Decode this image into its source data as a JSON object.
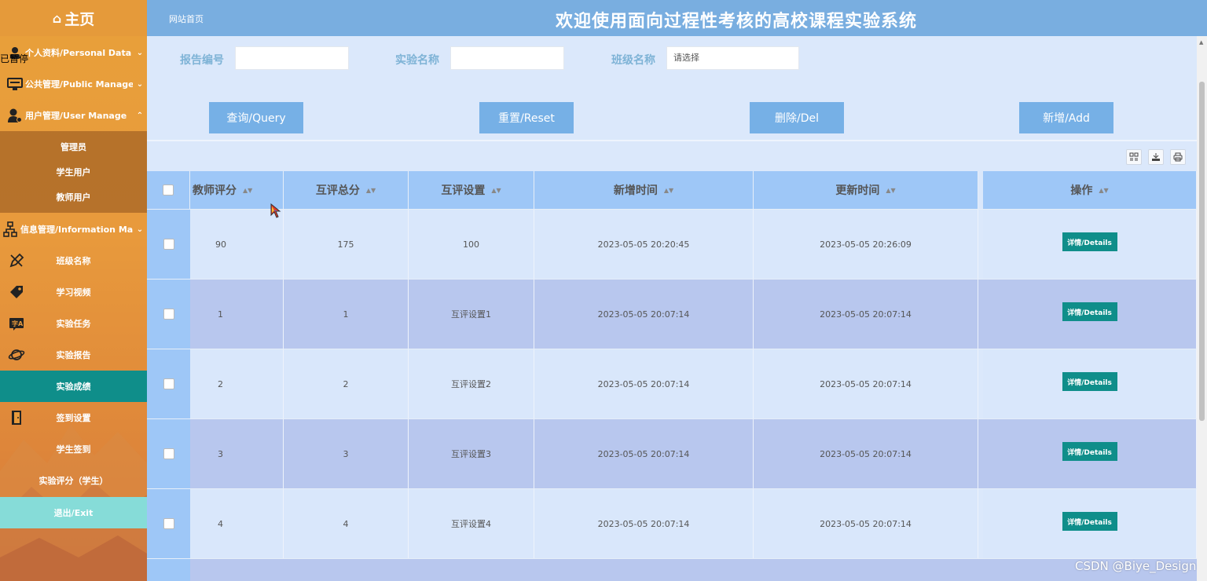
{
  "sidebar": {
    "home_label": "主页",
    "paused_label": "已暂停",
    "menus": [
      {
        "label": "个人资料/Personal Data",
        "chevron": "⌄"
      },
      {
        "label": "公共管理/Public Manage",
        "chevron": "⌄"
      },
      {
        "label": "用户管理/User Manage",
        "chevron": "⌃"
      },
      {
        "label": "信息管理/Information Manage",
        "chevron": "⌄"
      }
    ],
    "user_sub": [
      "管理员",
      "学生用户",
      "教师用户"
    ],
    "leaves": [
      "班级名称",
      "学习视频",
      "实验任务",
      "实验报告",
      "实验成绩",
      "签到设置",
      "学生签到",
      "实验评分（学生）",
      "退出/Exit"
    ]
  },
  "header": {
    "breadcrumb": "网站首页",
    "title": "欢迎使用面向过程性考核的高校课程实验系统"
  },
  "search": {
    "report_no_label": "报告编号",
    "report_no_value": "",
    "exp_name_label": "实验名称",
    "exp_name_value": "",
    "class_label": "班级名称",
    "class_placeholder": "请选择"
  },
  "buttons": {
    "query": "查询/Query",
    "reset": "重置/Reset",
    "delete": "删除/Del",
    "add": "新增/Add"
  },
  "table": {
    "columns": [
      "教师评分",
      "互评总分",
      "互评设置",
      "新增时间",
      "更新时间",
      "操作"
    ],
    "detail_label": "详情/Details",
    "rows": [
      {
        "teacher_score": "90",
        "peer_total": "175",
        "peer_setting": "100",
        "created": "2023-05-05 20:20:45",
        "updated": "2023-05-05 20:26:09"
      },
      {
        "teacher_score": "1",
        "peer_total": "1",
        "peer_setting": "互评设置1",
        "created": "2023-05-05 20:07:14",
        "updated": "2023-05-05 20:07:14"
      },
      {
        "teacher_score": "2",
        "peer_total": "2",
        "peer_setting": "互评设置2",
        "created": "2023-05-05 20:07:14",
        "updated": "2023-05-05 20:07:14"
      },
      {
        "teacher_score": "3",
        "peer_total": "3",
        "peer_setting": "互评设置3",
        "created": "2023-05-05 20:07:14",
        "updated": "2023-05-05 20:07:14"
      },
      {
        "teacher_score": "4",
        "peer_total": "4",
        "peer_setting": "互评设置4",
        "created": "2023-05-05 20:07:14",
        "updated": "2023-05-05 20:07:14"
      }
    ]
  },
  "watermark": "CSDN @Biye_Design",
  "colors": {
    "sidebar": "#e89a3c",
    "active": "#0f8e8a",
    "exit": "#86dcd8",
    "header": "#79aee0",
    "button": "#76b0e6",
    "table_head": "#9ec7f7",
    "row_odd": "#d9e7fb",
    "row_even": "#b8c7ee"
  }
}
